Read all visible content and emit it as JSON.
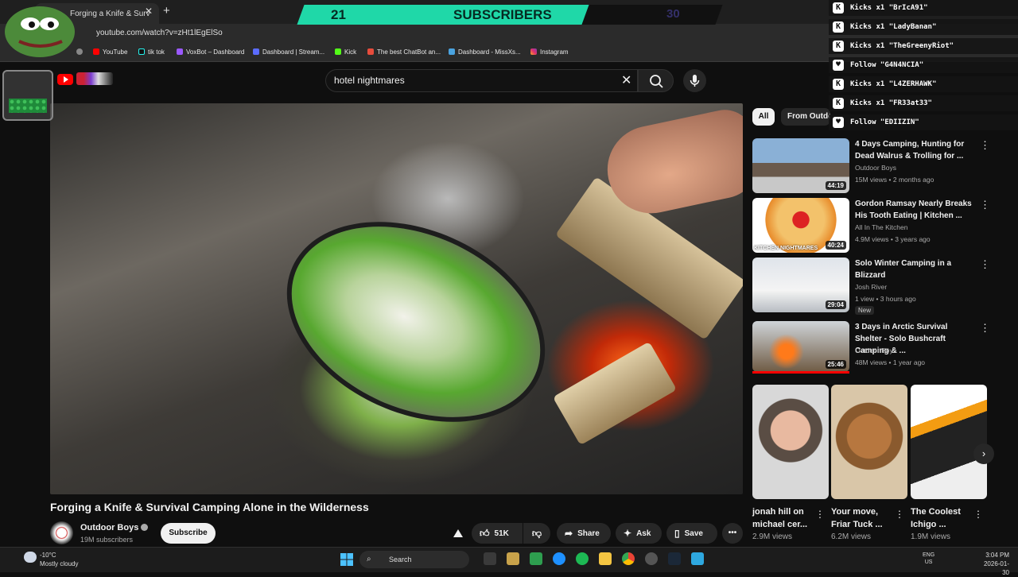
{
  "browser": {
    "tab_title": "Forging a Knife & Surv",
    "url": "youtube.com/watch?v=zHt1lEgElSo",
    "bookmarks": [
      "YouTube",
      "tik tok",
      "VoxBot – Dashboard",
      "Dashboard | Stream...",
      "Kick",
      "The best ChatBot an...",
      "Dashboard - MissXs...",
      "Instagram"
    ]
  },
  "overlay": {
    "sub_count": "21",
    "sub_label": "SUBSCRIBERS",
    "sub_goal": "30",
    "feed": [
      {
        "icon": "kick-icon",
        "text": "Kicks x1 \"BrIcA91\""
      },
      {
        "icon": "kick-icon",
        "text": "Kicks x1 \"LadyBanan\""
      },
      {
        "icon": "kick-icon",
        "text": "Kicks x1 \"TheGreenyRiot\""
      },
      {
        "icon": "heart-icon",
        "text": "Follow \"G4N4NCIA\""
      },
      {
        "icon": "kick-icon",
        "text": "Kicks x1 \"L4ZERHAWK\""
      },
      {
        "icon": "kick-icon",
        "text": "Kicks x1 \"FR33at33\""
      },
      {
        "icon": "heart-icon",
        "text": "Follow \"EDIIZIN\""
      }
    ],
    "accent": "#1fd8a8"
  },
  "youtube": {
    "search_value": "hotel nightmares",
    "video_title": "Forging a Knife & Survival Camping Alone in the Wilderness",
    "channel_name": "Outdoor Boys",
    "channel_subs": "19M subscribers",
    "subscribe_label": "Subscribe",
    "like_count": "51K",
    "share_label": "Share",
    "ask_label": "Ask",
    "save_label": "Save",
    "chips": [
      "All",
      "From Outdoor Boys"
    ],
    "recommendations": [
      {
        "title": "4 Days Camping, Hunting for Dead Walrus & Trolling for ...",
        "channel": "Outdoor Boys",
        "meta": "15M views • 2 months ago",
        "duration": "44:19",
        "badge": ""
      },
      {
        "title": "Gordon Ramsay Nearly Breaks His Tooth Eating | Kitchen ...",
        "channel": "All In The Kitchen",
        "meta": "4.9M views • 3 years ago",
        "duration": "40:24",
        "badge": ""
      },
      {
        "title": "Solo Winter Camping in a Blizzard",
        "channel": "Josh River",
        "meta": "1 view • 3 hours ago",
        "duration": "29:04",
        "badge": "New"
      },
      {
        "title": "3 Days in Arctic Survival Shelter - Solo Bushcraft Camping & ...",
        "channel": "Outdoor Boys",
        "meta": "48M views • 1 year ago",
        "duration": "25:46",
        "badge": ""
      }
    ],
    "thumb_caption_2": "KITCHEN NIGHTMARES",
    "shorts": [
      {
        "title": "jonah hill on michael cer...",
        "views": "2.9M views"
      },
      {
        "title": "Your move, Friar Tuck ...",
        "views": "6.2M views"
      },
      {
        "title": "The Coolest Ichigo ...",
        "views": "1.9M views"
      }
    ]
  },
  "taskbar": {
    "temp": "-10°C",
    "weather": "Mostly cloudy",
    "search_label": "Search",
    "lang": "ENG",
    "region": "US",
    "time": "3:04 PM",
    "date": "2026-01-30"
  }
}
